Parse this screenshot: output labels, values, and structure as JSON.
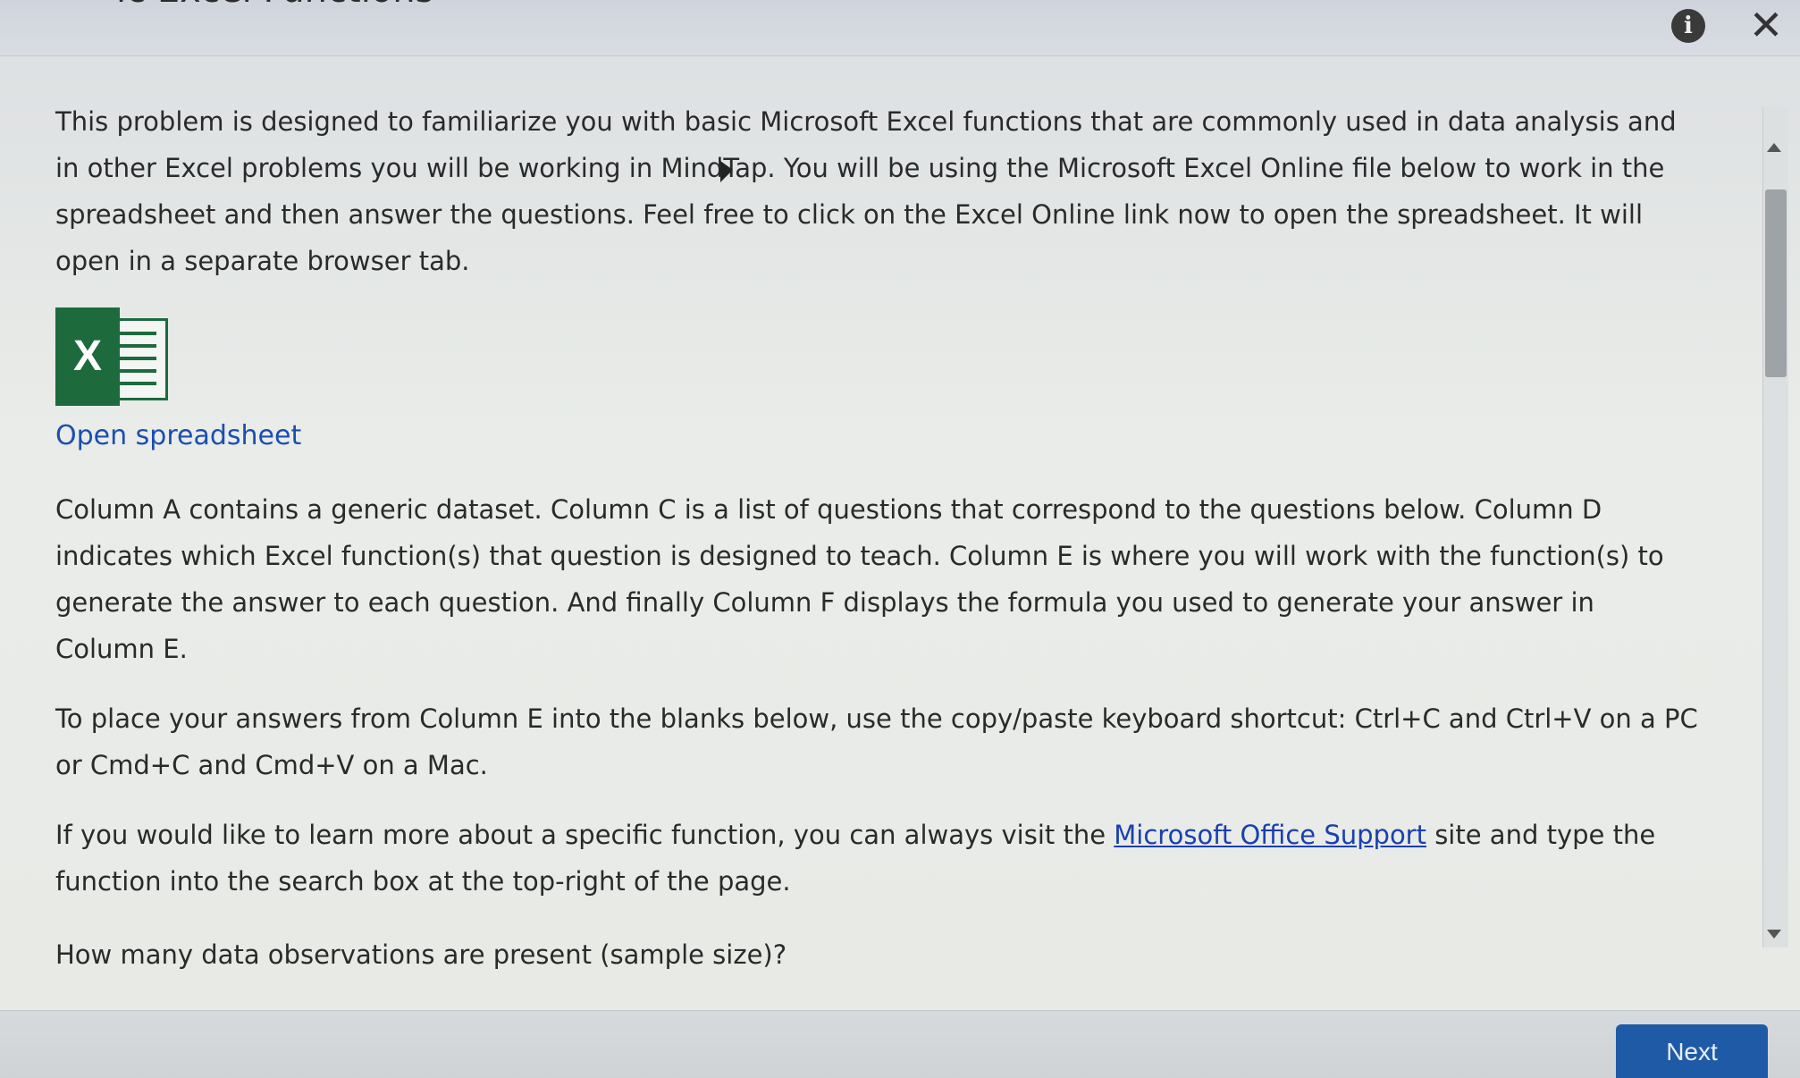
{
  "header": {
    "title": "ic Excel Functions",
    "info_icon": "info-icon",
    "close_icon": "close-icon",
    "info_glyph": "i",
    "close_glyph": "✕"
  },
  "content": {
    "intro": "This problem is designed to familiarize you with basic Microsoft Excel functions that are commonly used in data analysis and in other Excel problems you will be working in MindTap. You will be using the Microsoft Excel Online file below to work in the spreadsheet and then answer the questions. Feel free to click on the Excel Online link now to open the spreadsheet. It will open in a separate browser tab.",
    "excel_logo_letter": "X",
    "open_link": "Open spreadsheet",
    "columns_text": "Column A contains a generic dataset. Column C is a list of questions that correspond to the questions below. Column D indicates which Excel function(s) that question is designed to teach. Column E is where you will work with the function(s) to generate the answer to each question. And finally Column F displays the formula you used to generate your answer in Column E.",
    "paste_text": "To place your answers from Column E into the blanks below, use the copy/paste keyboard shortcut: Ctrl+C and Ctrl+V on a PC or Cmd+C and Cmd+V on a Mac.",
    "learn_prefix": "If you would like to learn more about a specific function, you can always visit the ",
    "support_link": "Microsoft Office Support",
    "learn_suffix": " site and type the function into the search box at the top-right of the page.",
    "question": "How many data observations are present (sample size)?"
  },
  "footer": {
    "next_label": "Next"
  },
  "colors": {
    "link": "#1a4fb0",
    "excel_green": "#1d6b3d",
    "next_button": "#1f5aa6"
  }
}
